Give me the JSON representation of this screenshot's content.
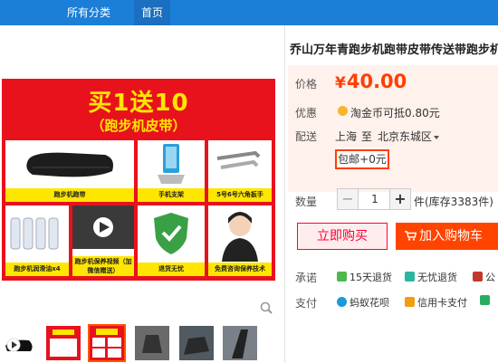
{
  "nav": {
    "all_categories": "所有分类",
    "home": "首页"
  },
  "product": {
    "title": "乔山万年青跑步机跑带皮带传送带跑步机履带",
    "price_label": "价格",
    "currency": "¥",
    "price": "40.00",
    "promo_label": "优惠",
    "promo_text": "淘金币可抵0.80元",
    "delivery_label": "配送",
    "from": "上海",
    "to_word": "至",
    "destination": "北京东城区",
    "shipping": "包邮+0元",
    "qty_label": "数量",
    "qty_value": "1",
    "unit": "件(库存3383件)",
    "buy_now": "立即购买",
    "add_cart": "加入购物车",
    "commit_label": "承诺",
    "commitments": [
      "15天退货",
      "无忧退货",
      "公"
    ],
    "pay_label": "支付",
    "payments": [
      "蚂蚁花呗",
      "信用卡支付",
      ""
    ]
  },
  "promo_image": {
    "headline": "买1送10",
    "sub": "（跑步机皮带）",
    "tiles": [
      "跑步机跑带",
      "手机支架",
      "5号6号六角扳手",
      "跑步机润滑油x4",
      "跑步机保养视频（加微信赠送）",
      "退货无忧",
      "免费咨询保养技术"
    ]
  },
  "colors": {
    "nav": "#1b7fd8",
    "accent": "#ff4400",
    "price": "#ff3e00",
    "promo_bg": "#e8121c",
    "promo_text": "#ffe600"
  },
  "icons": [
    "zoom-icon",
    "coin-icon",
    "cart-icon",
    "return-icon",
    "worry-free-icon",
    "huabei-icon",
    "credit-card-icon",
    "play-icon"
  ]
}
